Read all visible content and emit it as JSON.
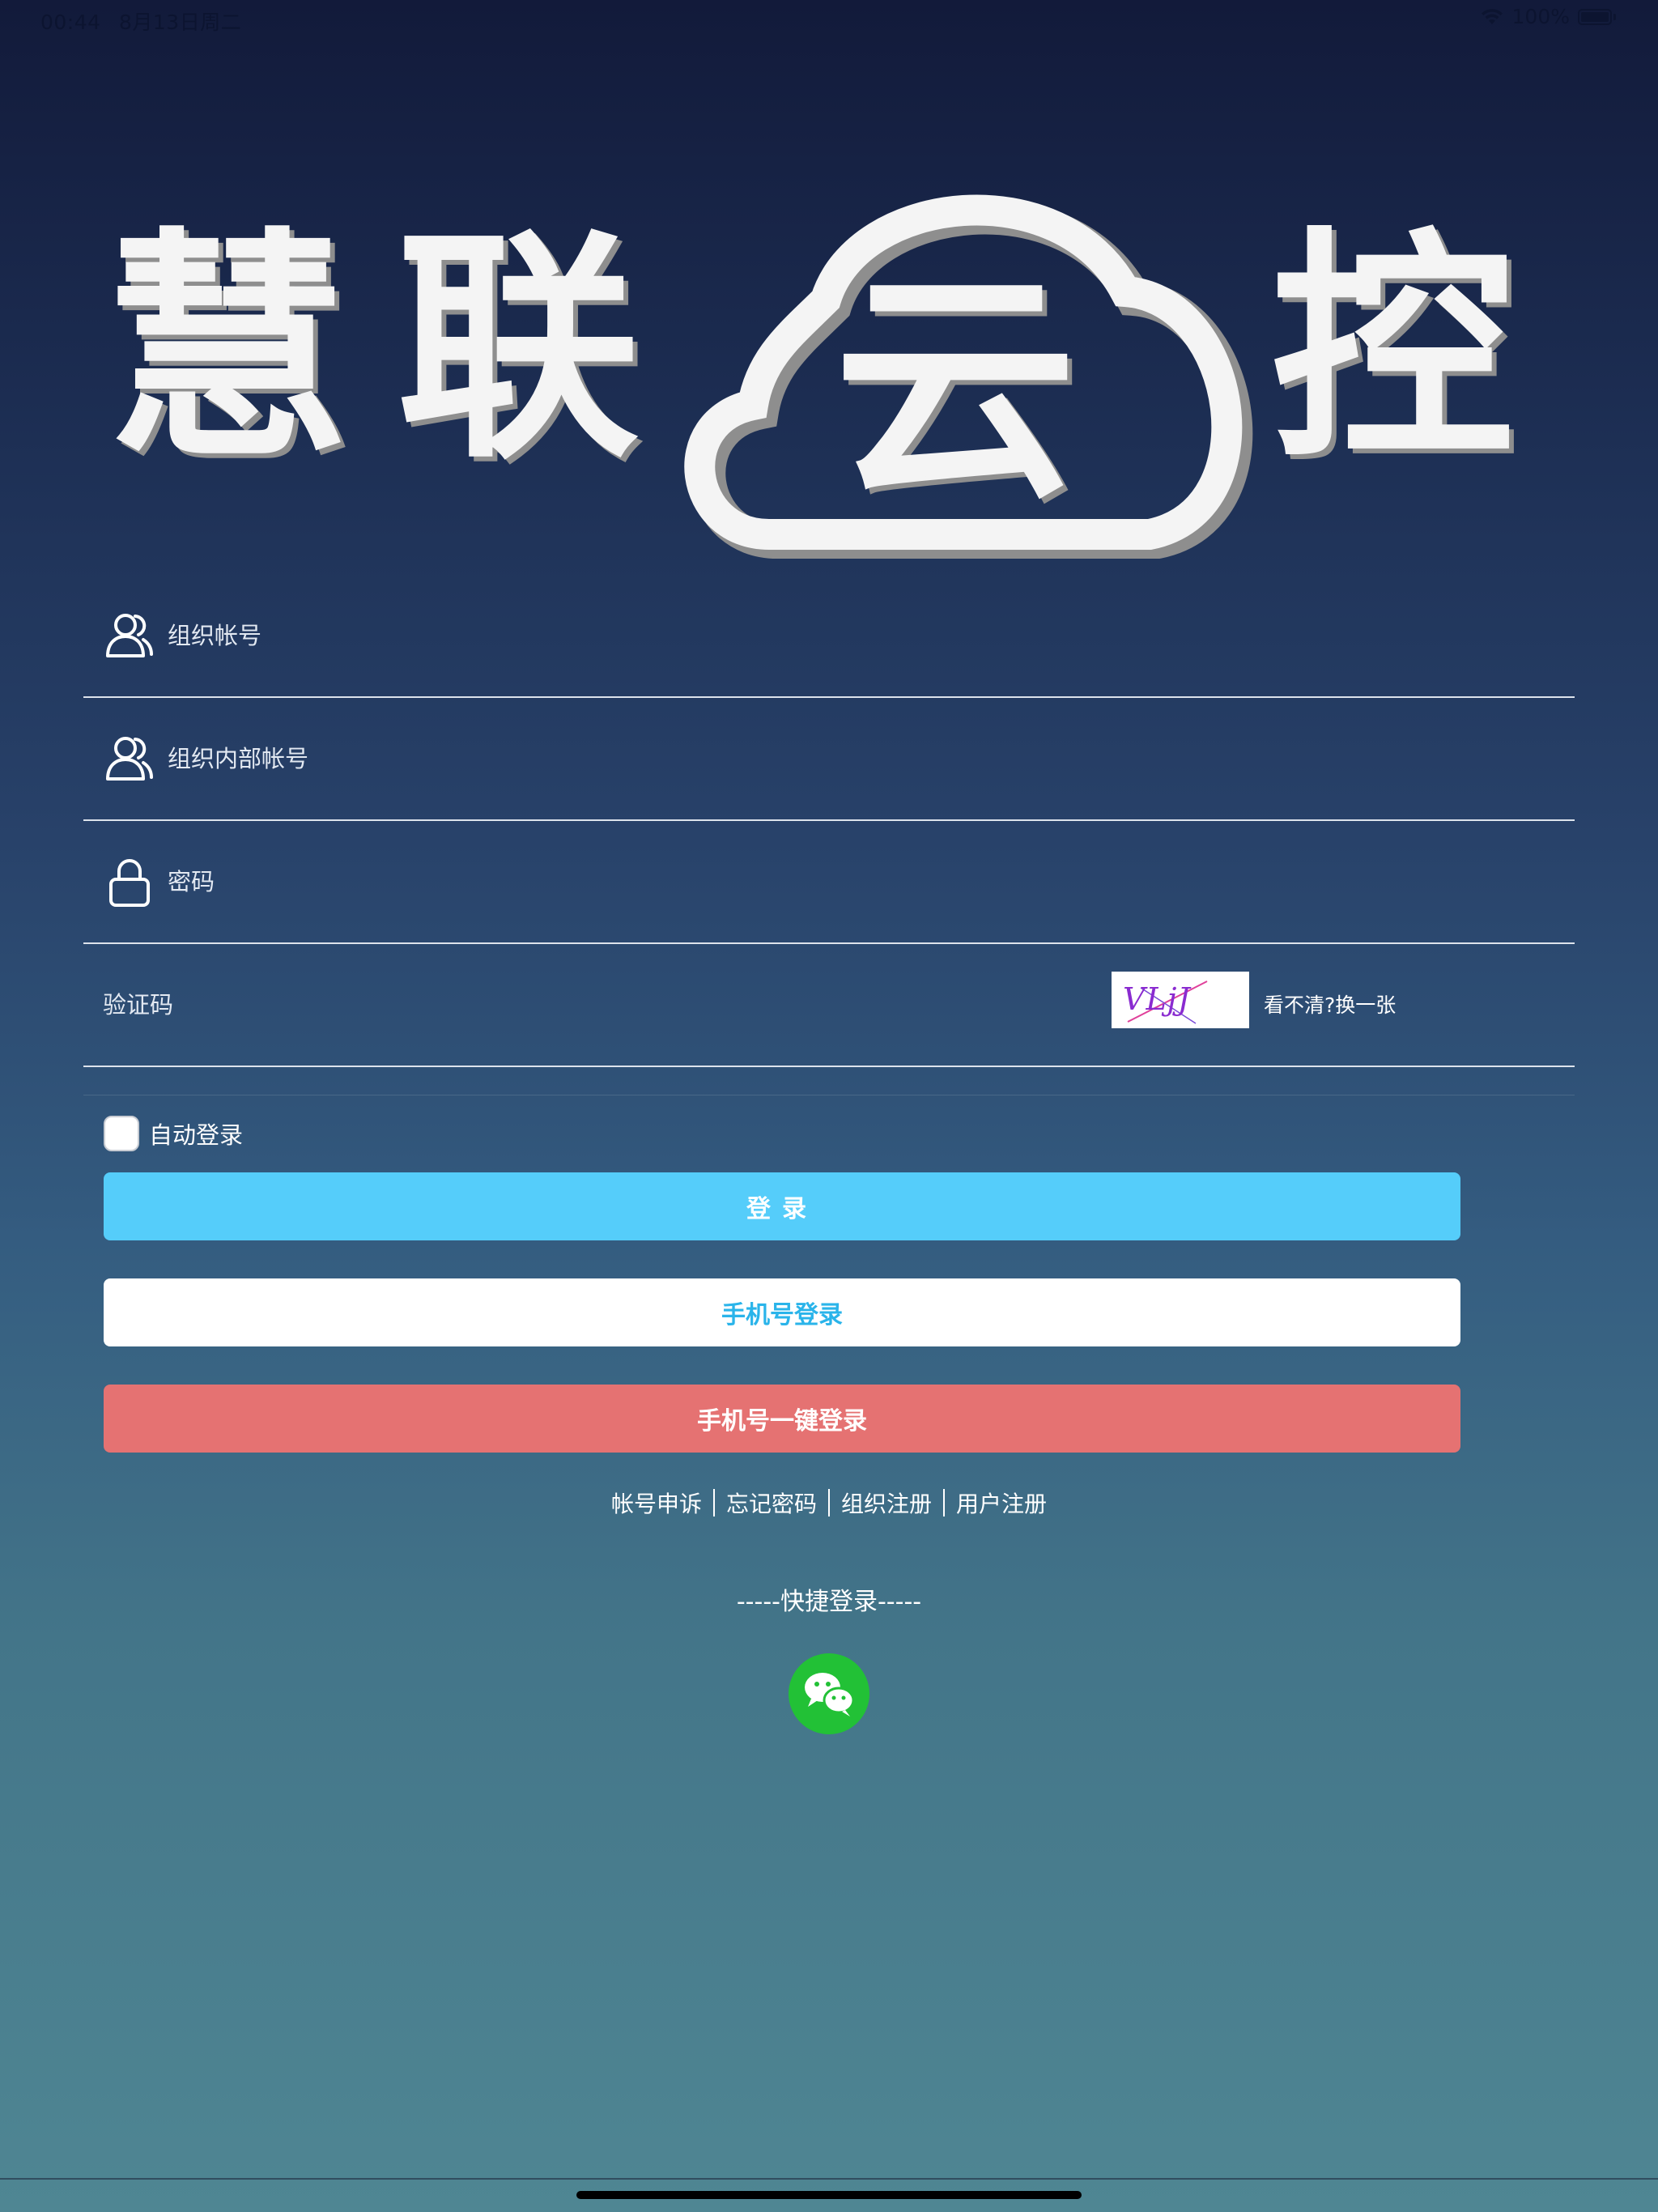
{
  "status_bar": {
    "time": "00:44",
    "date": "8月13日周二",
    "battery_text": "100%"
  },
  "logo": {
    "chars": [
      "慧",
      "联",
      "云",
      "控"
    ]
  },
  "form": {
    "org_account_placeholder": "组织帐号",
    "internal_account_placeholder": "组织内部帐号",
    "password_placeholder": "密码",
    "captcha_placeholder": "验证码",
    "captcha_code": "VLjJ",
    "captcha_refresh": "看不清?换一张"
  },
  "auto_login": {
    "label": "自动登录"
  },
  "buttons": {
    "login": "登录",
    "phone_login": "手机号登录",
    "one_key_login": "手机号一键登录"
  },
  "links": {
    "appeal": "帐号申诉",
    "forgot": "忘记密码",
    "org_register": "组织注册",
    "user_register": "用户注册"
  },
  "quick_login": {
    "title": "-----快捷登录-----"
  },
  "icons": {
    "user": "user-group-icon",
    "lock": "lock-icon",
    "wechat": "wechat-icon",
    "wifi": "wifi-icon",
    "battery": "battery-icon"
  },
  "colors": {
    "login_button": "#55cdfa",
    "phone_button_text": "#2ab4ea",
    "one_key_button": "#e57272",
    "wechat": "#22c136"
  }
}
